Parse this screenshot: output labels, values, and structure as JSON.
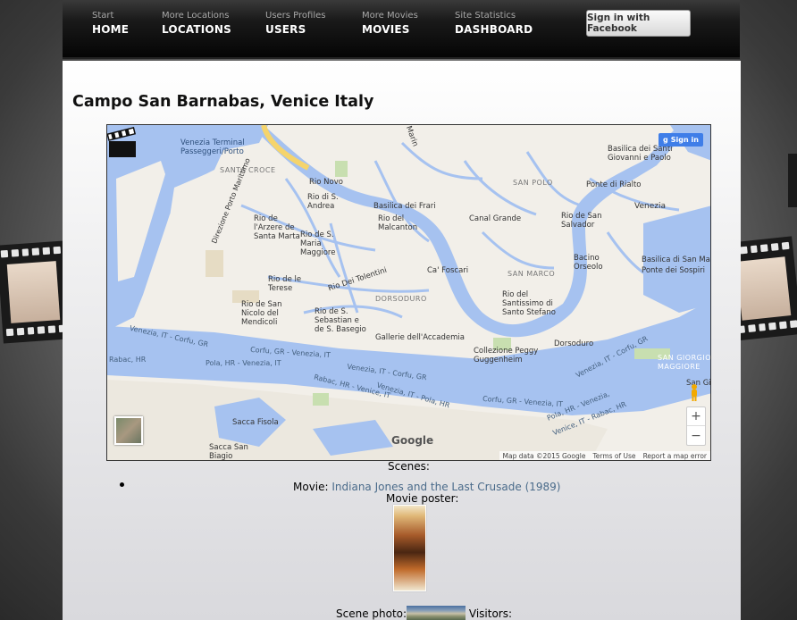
{
  "nav": {
    "items": [
      {
        "sub": "Start",
        "main": "HOME"
      },
      {
        "sub": "More Locations",
        "main": "LOCATIONS"
      },
      {
        "sub": "Users Profiles",
        "main": "USERS"
      },
      {
        "sub": "More Movies",
        "main": "MOVIES"
      },
      {
        "sub": "Site Statistics",
        "main": "DASHBOARD"
      }
    ],
    "facebook_button": "Sign in with Facebook"
  },
  "page": {
    "title": "Campo San Barnabas, Venice Italy"
  },
  "map": {
    "signin": "Sign in",
    "google": "Google",
    "footer": [
      "Map data ©2015 Google",
      "Terms of Use",
      "Report a map error"
    ],
    "zoom_in": "+",
    "zoom_out": "−",
    "labels": {
      "terminal": "Venezia Terminal\nPasseggeri/Porto",
      "santa_croce": "SANTA CROCE",
      "rio_novo": "Rio Novo",
      "rio_s_andrea": "Rio di S.\nAndrea",
      "rio_arzere": "Rio de\nl'Arzere de\nSanta Marta",
      "rio_maria": "Rio de S.\nMaria\nMaggiore",
      "rio_malcanton": "Rio del\nMalcanton",
      "basilica_frari": "Basilica dei Frari",
      "canal_grande": "Canal Grande",
      "rio_marin": "Rio Marin",
      "san_polo": "SAN POLO",
      "basilica_santi": "Basilica dei Santi\nGiovanni e Paolo",
      "ponte_rialto": "Ponte di Rialto",
      "venezia": "Venezia",
      "rio_san_salvador": "Rio de San\nSalvador",
      "ca_foscari": "Ca' Foscari",
      "rio_tolentini": "Rio Dei Tolentini",
      "rio_terese": "Rio de le\nTerese",
      "san_marco": "SAN MARCO",
      "bacino": "Bacino\nOrseolo",
      "basilica_san_marco": "Basilica di San Marco",
      "ponte_sospiri": "Ponte dei Sospiri",
      "rio_san_nicolo": "Rio de San\nNicolo del\nMendicoli",
      "dorsoduro": "DORSODURO",
      "rio_sebastian": "Rio de S.\nSebastian e\nde S. Basegio",
      "rio_santissimo": "Rio del\nSantissimo di\nSanto Stefano",
      "gallerie": "Gallerie dell'Accademia",
      "dorsoduro_place": "Dorsoduro",
      "peggy": "Collezione Peggy\nGuggenheim",
      "venezia_corfu1": "Venezia, IT - Corfu, GR",
      "corfu_venezia": "Corfu, GR - Venezia, IT",
      "rabac_hr": "Rabac, HR",
      "pola_hr": "Pola, HR - Venezia, IT",
      "venezia_corfu2": "Venezia, IT - Corfu, GR",
      "rabac_venice": "Rabac, HR - Venice, IT",
      "venezia_pola": "Venezia, IT - Pola, HR",
      "corfu_venezia2": "Corfu, GR - Venezia, IT",
      "sacca_fisola": "Sacca Fisola",
      "sacca_san_biagio": "Sacca San\nBiagio",
      "san_giorgio": "SAN GIORGIO\nMAGGIORE",
      "venezia_corfu3": "Venezia, IT - Corfu, GR",
      "pola_venezia2": "Pola, HR - Venezia,",
      "venice_rabac": "Venice, IT - Rabac, HR",
      "direzione": "Direzione Porto Marittimo",
      "san_giorgio_short": "San Gio"
    }
  },
  "scenes": {
    "label": "Scenes:",
    "movie_prefix": "Movie: ",
    "movie_title": "Indiana Jones and the Last Crusade (1989)",
    "poster_label": "Movie poster:",
    "scene_photo_label": "Scene photo:",
    "visitors_label": "Visitors:"
  },
  "colors": {
    "water": "#a6c2f0",
    "land": "#f2efe9",
    "accent_link": "#4a6b8a",
    "nav_bg": "#0a0a0a"
  }
}
